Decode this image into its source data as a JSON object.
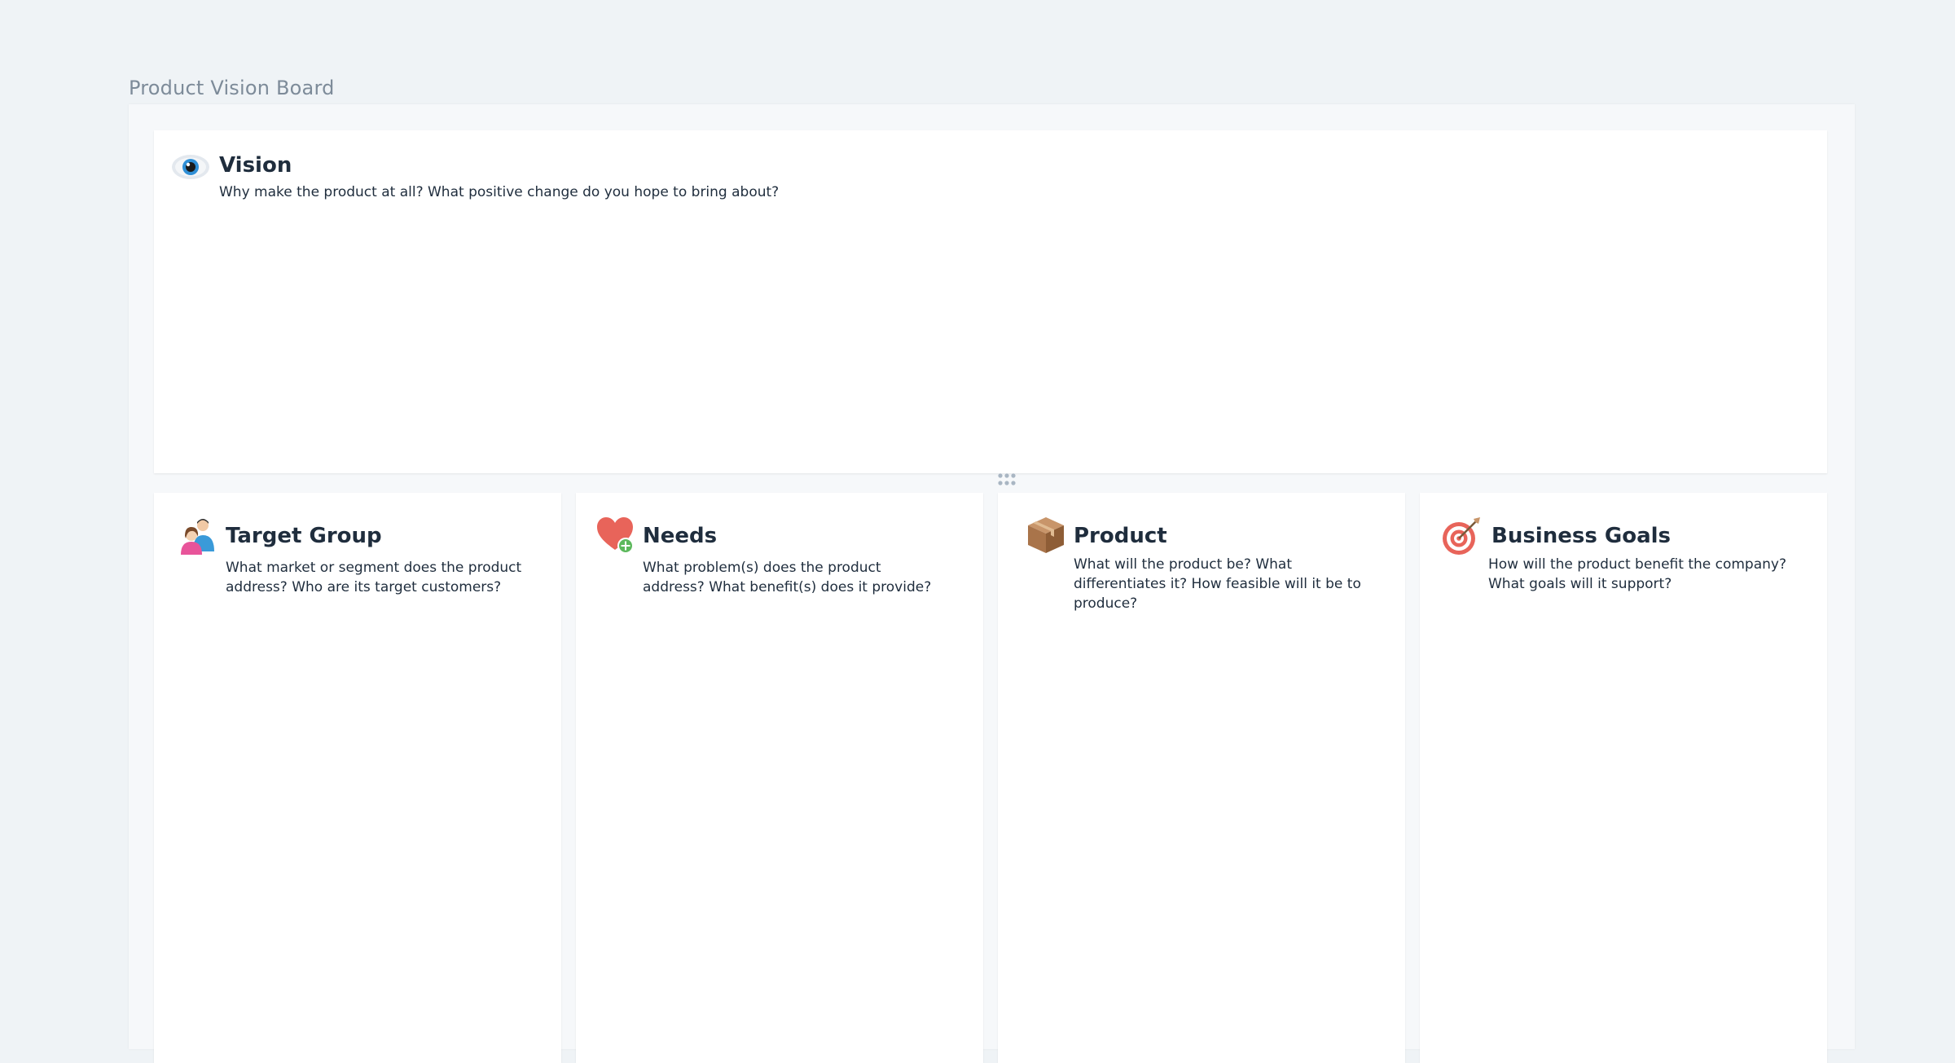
{
  "board": {
    "title": "Product Vision Board"
  },
  "sections": {
    "vision": {
      "heading": "Vision",
      "description": "Why make the product at all? What positive change do you hope to bring about?",
      "icon": "eye-icon"
    },
    "target_group": {
      "heading": "Target Group",
      "description": "What market or segment does the product address? Who are its target customers?",
      "icon": "people-icon"
    },
    "needs": {
      "heading": "Needs",
      "description": "What problem(s) does the product address? What benefit(s) does it provide?",
      "icon": "heart-plus-icon"
    },
    "product": {
      "heading": "Product",
      "description": "What will the product be? What differentiates it? How feasible will it be to produce?",
      "icon": "box-icon"
    },
    "business_goals": {
      "heading": "Business Goals",
      "description": "How will the product benefit the company? What goals will it support?",
      "icon": "target-icon"
    }
  },
  "colors": {
    "page_background": "#eff3f6",
    "frame_background": "#f6f8fa",
    "card_background": "#ffffff",
    "title_text": "#7d8b99",
    "body_text": "#1f2d3d",
    "handle_dots": "#a9b6c3"
  }
}
